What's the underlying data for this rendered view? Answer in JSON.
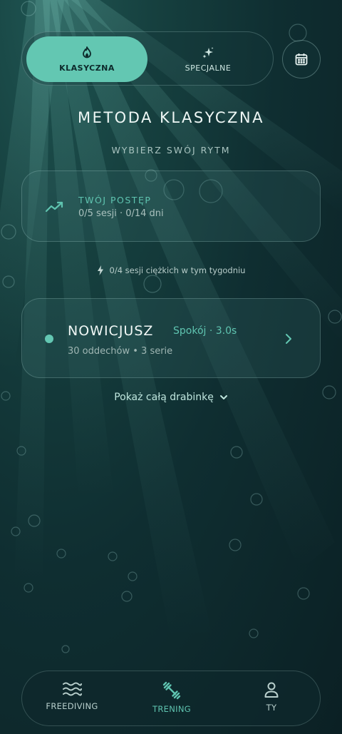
{
  "tabs": [
    {
      "label": "KLASYCZNA",
      "icon": "flame-icon",
      "active": true
    },
    {
      "label": "SPECJALNE",
      "icon": "sparkles-icon",
      "active": false
    }
  ],
  "calendar_button": {
    "icon": "calendar-icon"
  },
  "header": {
    "title": "METODA KLASYCZNA",
    "subtitle": "WYBIERZ SWÓJ RYTM"
  },
  "progress": {
    "icon": "trend-up-icon",
    "label": "TWÓJ POSTĘP",
    "value": "0/5 sesji · 0/14 dni"
  },
  "weekly_note": {
    "icon": "lightning-icon",
    "text": "0/4 sesji ciężkich w tym tygodniu"
  },
  "level": {
    "name": "NOWICJUSZ",
    "tag": "Spokój · 3.0s",
    "detail": "30 oddechów • 3 serie"
  },
  "ladder_link": {
    "label": "Pokaż całą drabinkę",
    "icon": "chevron-down-icon"
  },
  "nav": [
    {
      "label": "FREEDIVING",
      "icon": "waves-icon",
      "active": false
    },
    {
      "label": "TRENING",
      "icon": "dumbbell-icon",
      "active": true
    },
    {
      "label": "TY",
      "icon": "user-icon",
      "active": false
    }
  ],
  "colors": {
    "accent": "#63c7b2",
    "accent_text": "#5fc4b0",
    "background": "#0f2e31"
  }
}
